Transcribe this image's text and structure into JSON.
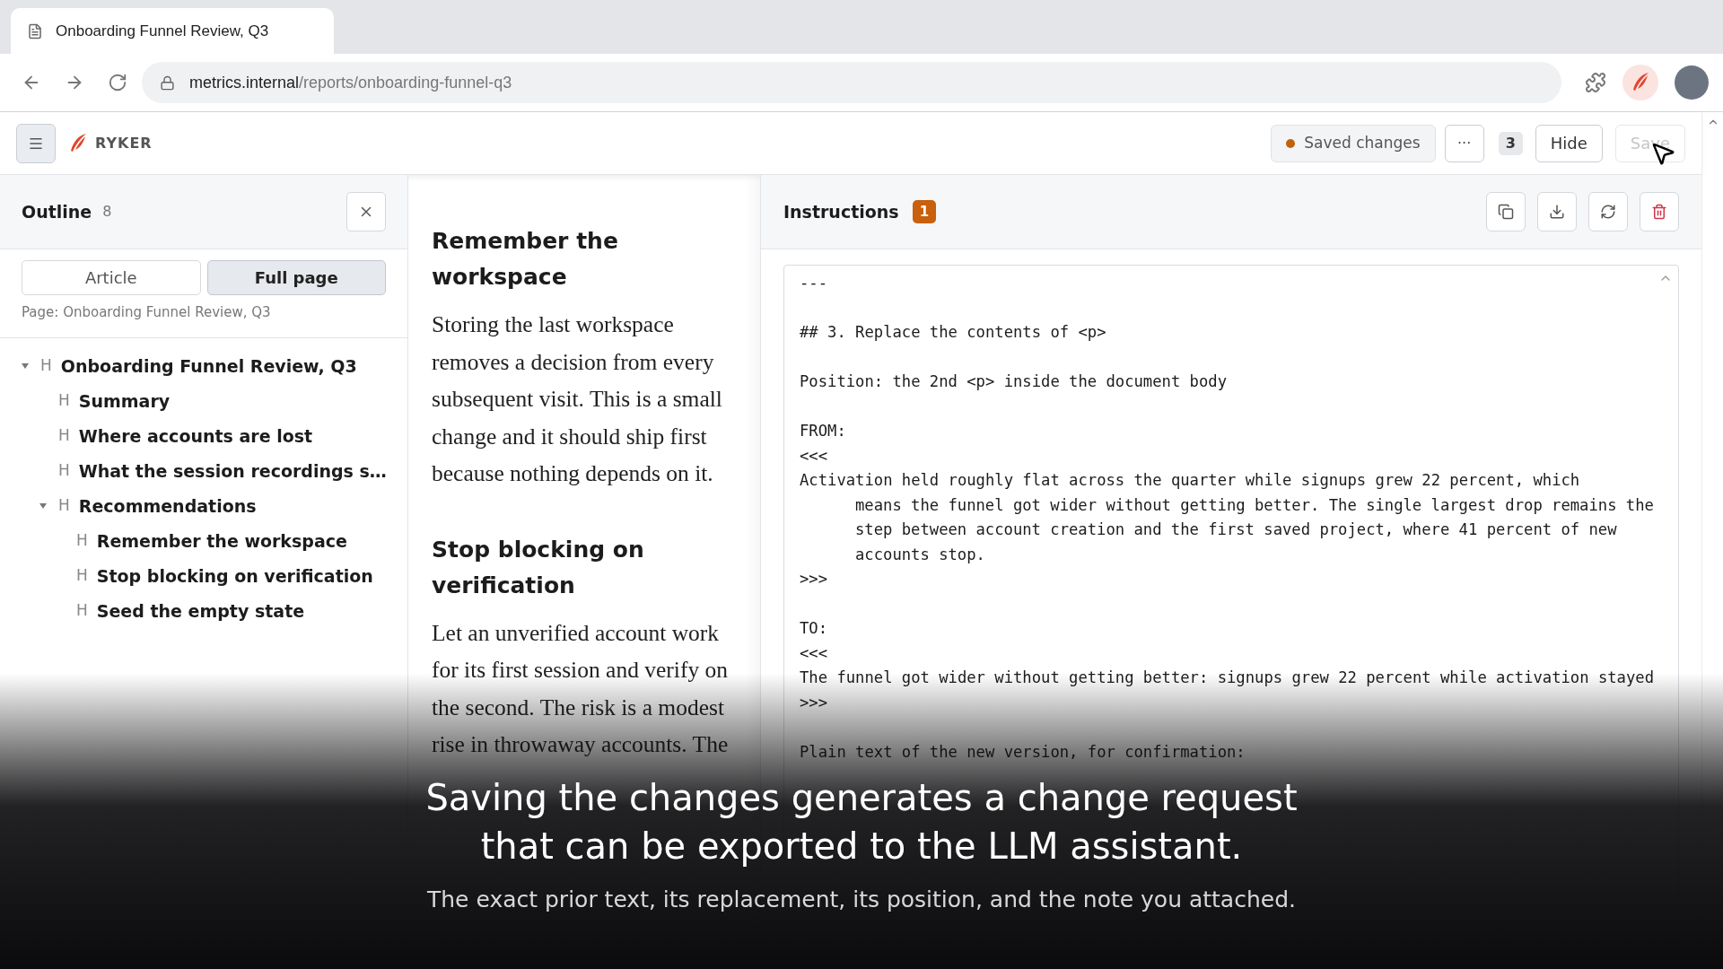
{
  "browser": {
    "tab_title": "Onboarding Funnel Review, Q3",
    "url": {
      "host": "metrics.internal",
      "path": "/reports/onboarding-funnel-q3"
    }
  },
  "header": {
    "brand": "RYKER",
    "status": {
      "label": "Saved changes",
      "color": "#c2610c"
    },
    "more": "···",
    "count": "3",
    "buttons": [
      {
        "label": "Hide",
        "disabled": false
      },
      {
        "label": "Save",
        "disabled": true
      }
    ]
  },
  "outline": {
    "title": "Outline",
    "count": "8",
    "toggles": [
      {
        "label": "Article",
        "selected": false
      },
      {
        "label": "Full page",
        "selected": true
      }
    ],
    "page_label": "Page: Onboarding Funnel Review, Q3",
    "tree": [
      {
        "marker": "H",
        "label": "Onboarding Funnel Review, Q3",
        "expanded": true,
        "children": [
          {
            "marker": "H",
            "label": "Summary"
          },
          {
            "marker": "H",
            "label": "Where accounts are lost"
          },
          {
            "marker": "H",
            "label": "What the session recordings s…"
          },
          {
            "marker": "H",
            "label": "Recommendations",
            "expanded": true,
            "children": [
              {
                "marker": "H",
                "label": "Remember the workspace"
              },
              {
                "marker": "H",
                "label": "Stop blocking on verification"
              },
              {
                "marker": "H",
                "label": "Seed the empty state"
              }
            ]
          }
        ]
      }
    ]
  },
  "article": {
    "sections": [
      {
        "heading": "Remember the workspace",
        "body": "Storing the last workspace removes a decision from every subsequent visit. This is a small change and it should ship first because nothing depends on it."
      },
      {
        "heading": "Stop blocking on verification",
        "body": "Let an unverified account work for its first session and verify on the second. The risk is a modest rise in throwaway accounts. The"
      }
    ]
  },
  "instructions": {
    "title": "Instructions",
    "badge": "1",
    "lines": [
      {
        "kind": "line",
        "text": "---"
      },
      {
        "kind": "blank"
      },
      {
        "kind": "line",
        "text": "## 3. Replace the contents of <p>"
      },
      {
        "kind": "blank"
      },
      {
        "kind": "line",
        "text": "Position: the 2nd <p> inside the document body"
      },
      {
        "kind": "blank"
      },
      {
        "kind": "line",
        "text": "FROM:"
      },
      {
        "kind": "line",
        "text": "<<<"
      },
      {
        "kind": "line",
        "text": "Activation held roughly flat across the quarter while signups grew 22 percent, which"
      },
      {
        "kind": "wrapped",
        "text": "means the funnel got wider without getting better. The single largest drop remains the"
      },
      {
        "kind": "wrapped",
        "text": "step between account creation and the first saved project, where 41 percent of new"
      },
      {
        "kind": "wrapped",
        "text": "accounts stop."
      },
      {
        "kind": "line",
        "text": ">>>"
      },
      {
        "kind": "blank"
      },
      {
        "kind": "line",
        "text": "TO:"
      },
      {
        "kind": "line",
        "text": "<<<"
      },
      {
        "kind": "line",
        "text": "The funnel got wider without getting better: signups grew 22 percent while activation stayed"
      },
      {
        "kind": "line",
        "text": ">>>"
      },
      {
        "kind": "blank"
      },
      {
        "kind": "line",
        "text": "Plain text of the new version, for confirmation:"
      }
    ]
  },
  "caption": {
    "title_lines": [
      "Saving the changes generates a change request",
      "that can be exported to the LLM assistant."
    ],
    "subtitle": "The exact prior text, its replacement, its position, and the note you attached."
  }
}
